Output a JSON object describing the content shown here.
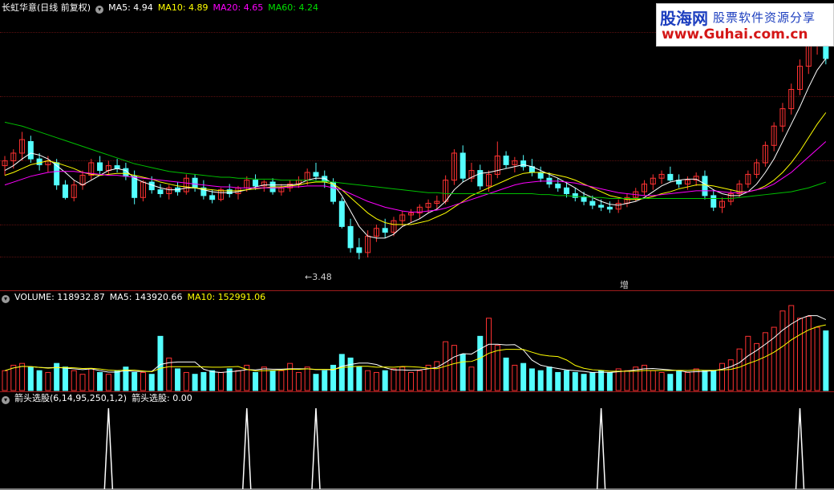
{
  "price_header": {
    "title": "长虹华意(日线 前复权)",
    "ma5": "MA5: 4.94",
    "ma10": "MA10: 4.89",
    "ma20": "MA20: 4.65",
    "ma60": "MA60: 4.24"
  },
  "volume_header": {
    "volume": "VOLUME: 118932.87",
    "ma5": "MA5: 143920.66",
    "ma10": "MA10: 152991.06"
  },
  "indicator_header": {
    "name": "箭头选股(6,14,95,250,1,2)",
    "value": "箭头选股: 0.00"
  },
  "annotations": {
    "low_price": "←3.48",
    "zeng": "增"
  },
  "logo": {
    "brand": "股海网",
    "slogan": "股票软件资源分享",
    "url": "www.Guhai.com.cn"
  },
  "colors": {
    "up": "#ff3232",
    "down": "#54ffff",
    "ma5": "#ffffff",
    "ma10": "#ffff00",
    "ma20": "#ff00ff",
    "ma60": "#00c000",
    "grid": "#5a1010",
    "separator": "#9e1b1b"
  },
  "chart_data": {
    "type": "candlestick",
    "y_range": [
      3.3,
      6.0
    ],
    "candles": [
      [
        4.45,
        4.55,
        4.35,
        4.5
      ],
      [
        4.5,
        4.62,
        4.42,
        4.58
      ],
      [
        4.58,
        4.8,
        4.5,
        4.72
      ],
      [
        4.7,
        4.76,
        4.48,
        4.52
      ],
      [
        4.52,
        4.58,
        4.4,
        4.46
      ],
      [
        4.46,
        4.55,
        4.38,
        4.5
      ],
      [
        4.48,
        4.52,
        4.2,
        4.25
      ],
      [
        4.25,
        4.3,
        4.1,
        4.12
      ],
      [
        4.12,
        4.3,
        4.08,
        4.25
      ],
      [
        4.25,
        4.4,
        4.2,
        4.35
      ],
      [
        4.35,
        4.52,
        4.3,
        4.48
      ],
      [
        4.48,
        4.55,
        4.36,
        4.4
      ],
      [
        4.4,
        4.5,
        4.36,
        4.45
      ],
      [
        4.45,
        4.52,
        4.38,
        4.42
      ],
      [
        4.42,
        4.48,
        4.3,
        4.34
      ],
      [
        4.34,
        4.4,
        4.05,
        4.12
      ],
      [
        4.12,
        4.3,
        4.08,
        4.28
      ],
      [
        4.28,
        4.34,
        4.16,
        4.2
      ],
      [
        4.2,
        4.26,
        4.12,
        4.16
      ],
      [
        4.16,
        4.25,
        4.1,
        4.22
      ],
      [
        4.22,
        4.28,
        4.14,
        4.18
      ],
      [
        4.18,
        4.36,
        4.15,
        4.32
      ],
      [
        4.32,
        4.36,
        4.18,
        4.22
      ],
      [
        4.22,
        4.3,
        4.1,
        4.14
      ],
      [
        4.14,
        4.2,
        4.06,
        4.1
      ],
      [
        4.1,
        4.22,
        4.08,
        4.2
      ],
      [
        4.2,
        4.26,
        4.12,
        4.16
      ],
      [
        4.16,
        4.24,
        4.1,
        4.22
      ],
      [
        4.22,
        4.34,
        4.18,
        4.3
      ],
      [
        4.3,
        4.36,
        4.2,
        4.24
      ],
      [
        4.24,
        4.3,
        4.18,
        4.28
      ],
      [
        4.28,
        4.32,
        4.15,
        4.18
      ],
      [
        4.18,
        4.26,
        4.14,
        4.22
      ],
      [
        4.22,
        4.3,
        4.18,
        4.26
      ],
      [
        4.26,
        4.34,
        4.22,
        4.3
      ],
      [
        4.3,
        4.42,
        4.25,
        4.38
      ],
      [
        4.38,
        4.48,
        4.3,
        4.34
      ],
      [
        4.34,
        4.4,
        4.22,
        4.28
      ],
      [
        4.28,
        4.32,
        4.05,
        4.08
      ],
      [
        4.08,
        4.12,
        3.8,
        3.82
      ],
      [
        3.82,
        3.9,
        3.55,
        3.6
      ],
      [
        3.6,
        3.7,
        3.48,
        3.55
      ],
      [
        3.55,
        3.78,
        3.5,
        3.72
      ],
      [
        3.72,
        3.84,
        3.66,
        3.8
      ],
      [
        3.8,
        3.9,
        3.7,
        3.76
      ],
      [
        3.76,
        3.92,
        3.72,
        3.88
      ],
      [
        3.88,
        3.98,
        3.82,
        3.94
      ],
      [
        3.94,
        4.0,
        3.86,
        3.96
      ],
      [
        3.96,
        4.05,
        3.9,
        4.02
      ],
      [
        4.02,
        4.1,
        3.96,
        4.06
      ],
      [
        4.06,
        4.14,
        4.0,
        4.08
      ],
      [
        4.08,
        4.35,
        4.05,
        4.3
      ],
      [
        4.3,
        4.62,
        4.25,
        4.58
      ],
      [
        4.58,
        4.66,
        4.28,
        4.32
      ],
      [
        4.32,
        4.48,
        4.28,
        4.4
      ],
      [
        4.4,
        4.46,
        4.2,
        4.24
      ],
      [
        4.24,
        4.4,
        4.18,
        4.36
      ],
      [
        4.36,
        4.7,
        4.32,
        4.55
      ],
      [
        4.55,
        4.6,
        4.42,
        4.46
      ],
      [
        4.46,
        4.54,
        4.38,
        4.5
      ],
      [
        4.5,
        4.56,
        4.4,
        4.44
      ],
      [
        4.44,
        4.52,
        4.34,
        4.38
      ],
      [
        4.38,
        4.44,
        4.28,
        4.32
      ],
      [
        4.32,
        4.38,
        4.22,
        4.26
      ],
      [
        4.26,
        4.32,
        4.18,
        4.22
      ],
      [
        4.22,
        4.28,
        4.12,
        4.16
      ],
      [
        4.16,
        4.22,
        4.08,
        4.12
      ],
      [
        4.12,
        4.18,
        4.04,
        4.08
      ],
      [
        4.08,
        4.14,
        4.0,
        4.04
      ],
      [
        4.04,
        4.1,
        3.98,
        4.02
      ],
      [
        4.02,
        4.08,
        3.96,
        4.0
      ],
      [
        4.0,
        4.1,
        3.96,
        4.06
      ],
      [
        4.06,
        4.16,
        4.02,
        4.12
      ],
      [
        4.12,
        4.22,
        4.08,
        4.18
      ],
      [
        4.18,
        4.3,
        4.14,
        4.26
      ],
      [
        4.26,
        4.36,
        4.2,
        4.32
      ],
      [
        4.32,
        4.4,
        4.26,
        4.36
      ],
      [
        4.36,
        4.44,
        4.28,
        4.3
      ],
      [
        4.3,
        4.36,
        4.22,
        4.26
      ],
      [
        4.26,
        4.34,
        4.2,
        4.3
      ],
      [
        4.3,
        4.38,
        4.24,
        4.34
      ],
      [
        4.34,
        4.4,
        4.1,
        4.14
      ],
      [
        4.14,
        4.2,
        3.98,
        4.02
      ],
      [
        4.02,
        4.12,
        3.96,
        4.08
      ],
      [
        4.08,
        4.2,
        4.04,
        4.16
      ],
      [
        4.16,
        4.3,
        4.12,
        4.26
      ],
      [
        4.26,
        4.4,
        4.22,
        4.36
      ],
      [
        4.36,
        4.52,
        4.32,
        4.48
      ],
      [
        4.48,
        4.7,
        4.44,
        4.66
      ],
      [
        4.66,
        4.9,
        4.6,
        4.86
      ],
      [
        4.86,
        5.1,
        4.8,
        5.04
      ],
      [
        5.04,
        5.3,
        4.98,
        5.24
      ],
      [
        5.24,
        5.55,
        5.18,
        5.48
      ],
      [
        5.48,
        5.8,
        5.4,
        5.7
      ],
      [
        5.7,
        5.98,
        5.6,
        5.86
      ],
      [
        5.86,
        5.95,
        5.5,
        5.56
      ]
    ],
    "ma_series": [
      {
        "name": "MA5",
        "values": [
          4.4,
          4.45,
          4.52,
          4.58,
          4.56,
          4.52,
          4.45,
          4.38,
          4.3,
          4.25,
          4.3,
          4.35,
          4.4,
          4.42,
          4.4,
          4.32,
          4.28,
          4.25,
          4.22,
          4.2,
          4.2,
          4.22,
          4.22,
          4.2,
          4.18,
          4.17,
          4.17,
          4.18,
          4.2,
          4.23,
          4.25,
          4.25,
          4.25,
          4.25,
          4.26,
          4.3,
          4.32,
          4.32,
          4.26,
          4.14,
          3.98,
          3.82,
          3.72,
          3.7,
          3.7,
          3.74,
          3.82,
          3.86,
          3.9,
          3.96,
          4.0,
          4.08,
          4.2,
          4.28,
          4.33,
          4.37,
          4.38,
          4.4,
          4.42,
          4.44,
          4.46,
          4.44,
          4.4,
          4.36,
          4.32,
          4.27,
          4.22,
          4.16,
          4.12,
          4.08,
          4.05,
          4.04,
          4.06,
          4.08,
          4.12,
          4.18,
          4.24,
          4.28,
          4.3,
          4.31,
          4.31,
          4.26,
          4.2,
          4.16,
          4.14,
          4.14,
          4.18,
          4.26,
          4.38,
          4.52,
          4.7,
          4.88,
          5.06,
          5.26,
          5.44,
          5.56
        ]
      },
      {
        "name": "MA10",
        "values": [
          4.35,
          4.38,
          4.42,
          4.46,
          4.48,
          4.5,
          4.48,
          4.45,
          4.42,
          4.38,
          4.36,
          4.35,
          4.36,
          4.37,
          4.37,
          4.35,
          4.33,
          4.31,
          4.28,
          4.26,
          4.24,
          4.23,
          4.22,
          4.21,
          4.2,
          4.19,
          4.19,
          4.19,
          4.2,
          4.21,
          4.22,
          4.23,
          4.23,
          4.24,
          4.25,
          4.27,
          4.28,
          4.28,
          4.26,
          4.2,
          4.12,
          4.04,
          3.96,
          3.9,
          3.86,
          3.84,
          3.84,
          3.84,
          3.86,
          3.88,
          3.92,
          3.96,
          4.02,
          4.08,
          4.14,
          4.18,
          4.22,
          4.26,
          4.3,
          4.34,
          4.37,
          4.38,
          4.38,
          4.37,
          4.35,
          4.33,
          4.3,
          4.26,
          4.22,
          4.18,
          4.14,
          4.12,
          4.1,
          4.1,
          4.11,
          4.13,
          4.16,
          4.18,
          4.21,
          4.23,
          4.25,
          4.25,
          4.24,
          4.22,
          4.2,
          4.18,
          4.18,
          4.2,
          4.24,
          4.3,
          4.38,
          4.48,
          4.6,
          4.74,
          4.88,
          5.0
        ]
      },
      {
        "name": "MA20",
        "values": [
          4.25,
          4.28,
          4.31,
          4.34,
          4.36,
          4.38,
          4.39,
          4.39,
          4.39,
          4.38,
          4.37,
          4.36,
          4.35,
          4.35,
          4.34,
          4.33,
          4.32,
          4.31,
          4.3,
          4.29,
          4.28,
          4.27,
          4.26,
          4.25,
          4.24,
          4.23,
          4.23,
          4.22,
          4.22,
          4.22,
          4.22,
          4.22,
          4.22,
          4.23,
          4.23,
          4.24,
          4.24,
          4.24,
          4.22,
          4.2,
          4.16,
          4.12,
          4.08,
          4.05,
          4.02,
          4.0,
          3.98,
          3.97,
          3.97,
          3.98,
          3.99,
          4.01,
          4.04,
          4.07,
          4.1,
          4.13,
          4.16,
          4.19,
          4.22,
          4.25,
          4.27,
          4.28,
          4.29,
          4.29,
          4.29,
          4.28,
          4.27,
          4.25,
          4.23,
          4.21,
          4.19,
          4.17,
          4.16,
          4.15,
          4.14,
          4.14,
          4.15,
          4.16,
          4.17,
          4.18,
          4.19,
          4.19,
          4.19,
          4.18,
          4.17,
          4.17,
          4.18,
          4.2,
          4.22,
          4.26,
          4.32,
          4.38,
          4.46,
          4.54,
          4.62,
          4.7
        ]
      },
      {
        "name": "MA60",
        "values": [
          4.9,
          4.88,
          4.86,
          4.83,
          4.8,
          4.77,
          4.74,
          4.71,
          4.68,
          4.65,
          4.62,
          4.59,
          4.56,
          4.53,
          4.5,
          4.47,
          4.45,
          4.43,
          4.41,
          4.39,
          4.38,
          4.37,
          4.36,
          4.35,
          4.34,
          4.33,
          4.33,
          4.32,
          4.32,
          4.31,
          4.31,
          4.31,
          4.3,
          4.3,
          4.3,
          4.3,
          4.29,
          4.29,
          4.28,
          4.27,
          4.26,
          4.25,
          4.24,
          4.23,
          4.22,
          4.21,
          4.2,
          4.19,
          4.18,
          4.17,
          4.17,
          4.16,
          4.16,
          4.16,
          4.16,
          4.16,
          4.16,
          4.16,
          4.16,
          4.16,
          4.16,
          4.16,
          4.15,
          4.15,
          4.14,
          4.14,
          4.13,
          4.13,
          4.12,
          4.12,
          4.11,
          4.11,
          4.11,
          4.11,
          4.11,
          4.11,
          4.11,
          4.11,
          4.11,
          4.11,
          4.11,
          4.11,
          4.11,
          4.11,
          4.11,
          4.12,
          4.13,
          4.14,
          4.15,
          4.16,
          4.17,
          4.18,
          4.2,
          4.22,
          4.25,
          4.28
        ]
      }
    ],
    "volume": [
      22,
      28,
      30,
      26,
      22,
      20,
      30,
      26,
      22,
      18,
      24,
      20,
      18,
      22,
      26,
      20,
      20,
      18,
      60,
      36,
      24,
      20,
      18,
      20,
      22,
      20,
      24,
      22,
      28,
      20,
      26,
      22,
      22,
      30,
      20,
      26,
      18,
      22,
      28,
      40,
      36,
      26,
      22,
      20,
      22,
      24,
      26,
      20,
      22,
      28,
      32,
      54,
      50,
      40,
      26,
      60,
      80,
      50,
      36,
      28,
      30,
      24,
      22,
      26,
      20,
      22,
      20,
      18,
      20,
      22,
      20,
      24,
      22,
      26,
      28,
      22,
      20,
      18,
      22,
      20,
      24,
      22,
      22,
      30,
      34,
      46,
      60,
      52,
      64,
      70,
      88,
      94,
      80,
      82,
      70,
      66
    ],
    "indicator_spikes": [
      12,
      28,
      36,
      69,
      92,
      121,
      148
    ]
  }
}
